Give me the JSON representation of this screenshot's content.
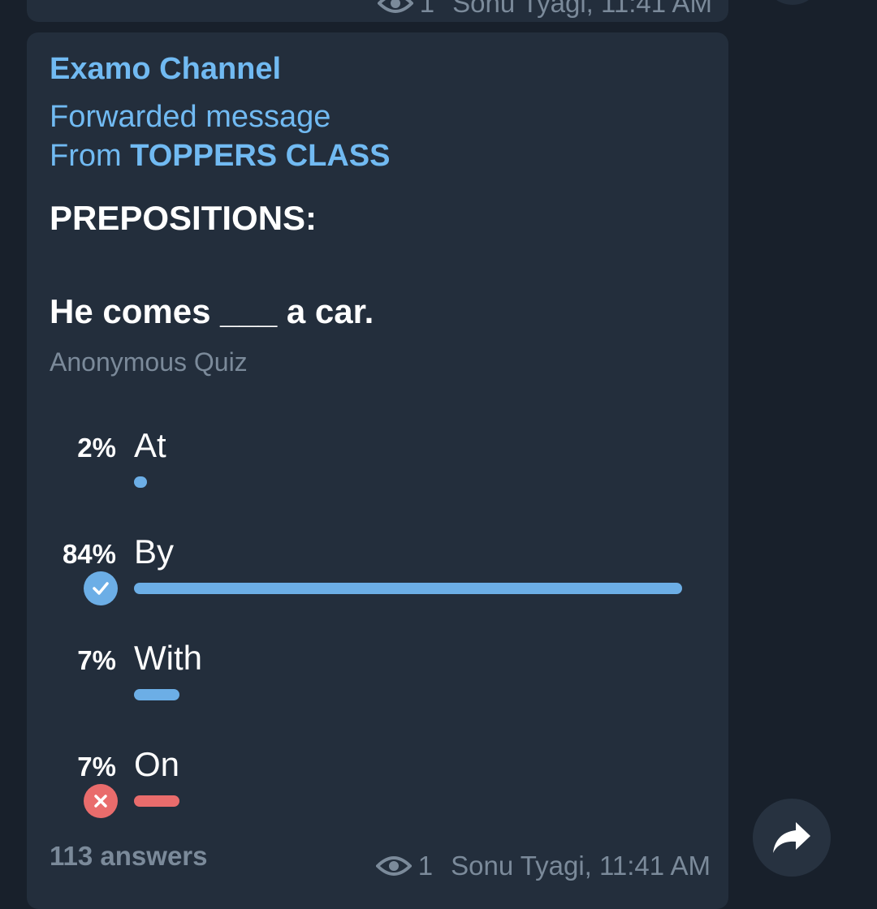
{
  "previous_message": {
    "views": "1",
    "signature": "Sonu Tyagi, 11:41 AM"
  },
  "message": {
    "channel_name": "Examo Channel",
    "forwarded_label": "Forwarded message",
    "from_prefix": "From ",
    "from_source": "TOPPERS CLASS",
    "poll": {
      "title": "PREPOSITIONS:",
      "question": "He comes ___ a car.",
      "type": "Anonymous Quiz",
      "options": [
        {
          "percent_label": "2%",
          "text": "At",
          "fraction": 0.02,
          "status": "none"
        },
        {
          "percent_label": "84%",
          "text": "By",
          "fraction": 0.84,
          "status": "correct"
        },
        {
          "percent_label": "7%",
          "text": "With",
          "fraction": 0.07,
          "status": "none"
        },
        {
          "percent_label": "7%",
          "text": "On",
          "fraction": 0.07,
          "status": "incorrect"
        }
      ],
      "answers_count": "113 answers"
    },
    "views": "1",
    "signature": "Sonu Tyagi, 11:41 AM"
  },
  "icons": {
    "views": "eye-icon",
    "share": "share-arrow-icon",
    "correct": "checkmark-icon",
    "incorrect": "cross-icon"
  },
  "colors": {
    "background": "#18202b",
    "bubble": "#232e3c",
    "accent": "#71baf2",
    "bar": "#6caee6",
    "wrong": "#e96c6c",
    "muted": "#7b8a9a"
  }
}
